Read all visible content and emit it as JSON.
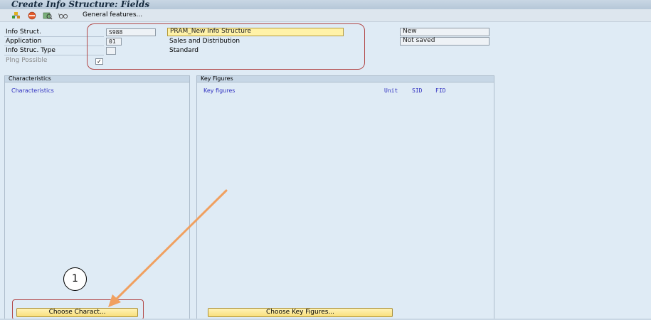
{
  "window": {
    "title": "Create Info Structure: Fields"
  },
  "toolbar": {
    "general_features": "General features..."
  },
  "header_fields": {
    "info_struct": {
      "label": "Info Struct.",
      "value": "S988",
      "description": "PRAM_New Info Structure",
      "status": "New"
    },
    "application": {
      "label": "Application",
      "value": "01",
      "description": "Sales and Distribution",
      "status": "Not saved"
    },
    "info_struc_type": {
      "label": "Info Struc. Type",
      "value": "",
      "description": "Standard"
    },
    "planning_possible": {
      "label": "Plng Possible",
      "checked_mark": "✓"
    }
  },
  "characteristics_panel": {
    "title": "Characteristics",
    "column_header": "Characteristics",
    "button_label": "Choose Charact..."
  },
  "key_figures_panel": {
    "title": "Key Figures",
    "column_header": "Key figures",
    "col_unit": "Unit",
    "col_sid": "SID",
    "col_fid": "FID",
    "button_label": "Choose Key Figures..."
  },
  "annotation": {
    "step_number": "1"
  },
  "colors": {
    "highlight_red": "#b24848",
    "arrow_orange": "#f0a060",
    "button_yellow": "#f9df7c"
  }
}
